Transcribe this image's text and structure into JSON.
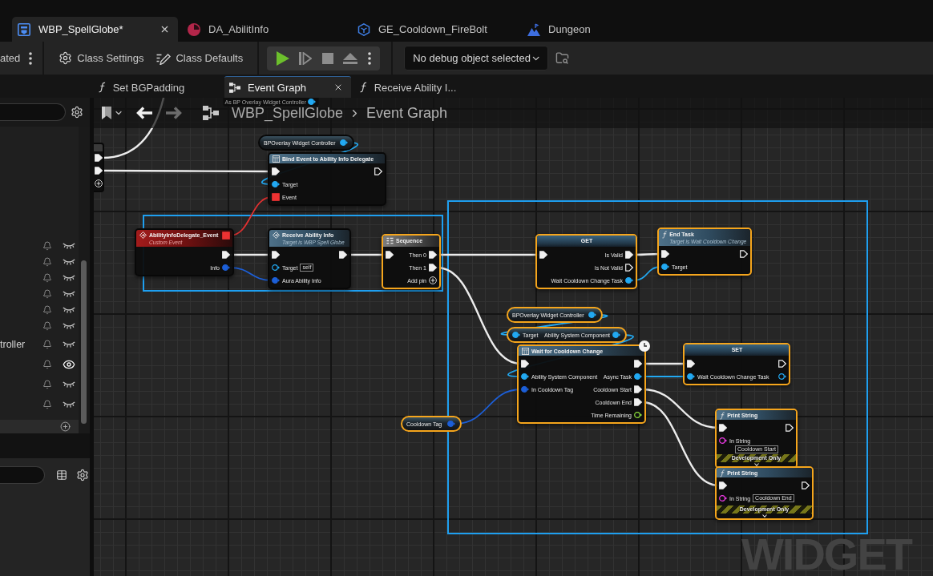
{
  "document_tabs": [
    {
      "label": "WBP_SpellGlobe*",
      "kind": "widget",
      "selected": true
    },
    {
      "label": "DA_AbilitInfo",
      "kind": "data_asset",
      "selected": false
    },
    {
      "label": "GE_Cooldown_FireBolt",
      "kind": "effect",
      "selected": false
    },
    {
      "label": "Dungeon",
      "kind": "level",
      "selected": false
    }
  ],
  "toolbar": {
    "buttons": [
      {
        "label": "ated",
        "kind": "plain"
      },
      {
        "label": "Class Settings",
        "kind": "settings"
      },
      {
        "label": "Class Defaults",
        "kind": "defaults"
      }
    ],
    "play_controls": [
      {
        "kind": "play",
        "disabled": false
      },
      {
        "kind": "step",
        "disabled": true
      },
      {
        "kind": "stop",
        "disabled": true
      },
      {
        "kind": "eject",
        "disabled": true
      }
    ],
    "debug_dropdown": {
      "value": "No debug object selected"
    }
  },
  "graph_tabs": [
    {
      "label": "Set BGPadding",
      "kind": "function",
      "selected": false
    },
    {
      "label": "Event Graph",
      "kind": "graph",
      "selected": true
    },
    {
      "label": "Receive Ability I...",
      "kind": "function",
      "selected": false
    }
  ],
  "left_panel": {
    "rows": [
      {
        "shown": false
      },
      {
        "shown": false
      },
      {
        "shown": false
      },
      {
        "shown": false
      },
      {
        "shown": false
      },
      {
        "shown": false
      },
      {
        "label": "troller",
        "shown": false
      },
      {
        "shown": true
      },
      {
        "shown": false
      },
      {
        "shown": false
      }
    ]
  },
  "breadcrumb": {
    "nav": [
      {
        "kind": "back",
        "disabled": false
      },
      {
        "kind": "forward",
        "disabled": true
      }
    ],
    "path": [
      "WBP_SpellGlobe",
      "Event Graph"
    ]
  },
  "graph": {
    "nodes": [
      {
        "kind": "fragment",
        "selected": false,
        "outputs": [
          {
            "kind": "exec",
            "connected": true
          },
          {
            "kind": "exec",
            "connected": true
          },
          {
            "kind": "add"
          }
        ]
      },
      {
        "kind": "partial",
        "selected": false,
        "outputs": [
          {
            "label": "As BP Overlay Widget Controller",
            "kind": "object",
            "connected": true
          }
        ]
      },
      {
        "kind": "getter",
        "title": "BPOverlay Widget Controller",
        "selected": false,
        "outputs": [
          {
            "kind": "object",
            "connected": true
          }
        ]
      },
      {
        "kind": "function",
        "title": "Bind Event to Ability Info Delegate",
        "icon": {
          "kind": "node"
        },
        "selected": false,
        "inputs": [
          {
            "kind": "exec",
            "connected": true
          },
          {
            "label": "Target",
            "kind": "object",
            "connected": true
          },
          {
            "label": "Event",
            "kind": "delegate",
            "connected": true
          }
        ],
        "outputs": [
          {
            "kind": "exec",
            "connected": false
          }
        ]
      },
      {
        "kind": "event",
        "title": "AbilityInfoDelegate_Event",
        "subtitle": "Custom Event",
        "icon": {
          "kind": "event"
        },
        "selected": false,
        "header_pin": {
          "kind": "delegate",
          "connected": true
        },
        "outputs": [
          {
            "kind": "exec",
            "connected": true
          },
          {
            "label": "Info",
            "kind": "struct",
            "connected": true
          }
        ]
      },
      {
        "kind": "function",
        "title": "Receive Ability Info",
        "subtitle": "Target is WBP Spell Globe",
        "icon": {
          "kind": "event"
        },
        "selected": false,
        "inputs": [
          {
            "kind": "exec",
            "connected": true
          },
          {
            "label": "Target",
            "kind": "object",
            "connected": false,
            "value": "self"
          },
          {
            "label": "Aura Ability Info",
            "kind": "struct",
            "connected": true
          }
        ],
        "outputs": [
          {
            "kind": "exec",
            "connected": true
          }
        ]
      },
      {
        "kind": "sequence",
        "title": "Sequence",
        "icon": {
          "kind": "sequence"
        },
        "selected": true,
        "inputs": [
          {
            "kind": "exec",
            "connected": true
          }
        ],
        "outputs": [
          {
            "label": "Then 0",
            "kind": "exec",
            "connected": true
          },
          {
            "label": "Then 1",
            "kind": "exec",
            "connected": true
          },
          {
            "label": "Add pin",
            "kind": "add"
          }
        ]
      },
      {
        "kind": "variable",
        "title": "GET",
        "selected": true,
        "inputs": [
          {
            "kind": "exec",
            "connected": true
          }
        ],
        "outputs": [
          {
            "label": "Is Valid",
            "kind": "exec",
            "connected": true
          },
          {
            "label": "Is Not Valid",
            "kind": "exec",
            "connected": false
          },
          {
            "label": "Wait Cooldown Change Task",
            "kind": "object",
            "connected": true
          }
        ]
      },
      {
        "kind": "function",
        "title": "End Task",
        "subtitle": "Target is Wait Cooldown Change",
        "icon": {
          "kind": "function"
        },
        "selected": true,
        "inputs": [
          {
            "kind": "exec",
            "connected": true
          },
          {
            "label": "Target",
            "kind": "object",
            "connected": true
          }
        ],
        "outputs": [
          {
            "kind": "exec",
            "connected": false
          }
        ]
      },
      {
        "kind": "getter",
        "title": "BPOverlay Widget Controller",
        "selected": true,
        "outputs": [
          {
            "kind": "object",
            "connected": true
          }
        ]
      },
      {
        "kind": "compact",
        "selected": true,
        "inputs": [
          {
            "label": "Target",
            "kind": "object",
            "connected": true
          }
        ],
        "outputs": [
          {
            "label": "Ability System Component",
            "kind": "object",
            "connected": true
          }
        ]
      },
      {
        "kind": "function",
        "title": "Wait for Cooldown Change",
        "icon": {
          "kind": "node"
        },
        "latent": true,
        "selected": true,
        "inputs": [
          {
            "kind": "exec",
            "connected": true
          },
          {
            "label": "Ability System Component",
            "kind": "object",
            "connected": true
          },
          {
            "label": "In Cooldown Tag",
            "kind": "struct",
            "connected": true
          }
        ],
        "outputs": [
          {
            "kind": "exec",
            "connected": true
          },
          {
            "label": "Async Task",
            "kind": "object",
            "connected": true
          },
          {
            "label": "Cooldown Start",
            "kind": "exec",
            "connected": true
          },
          {
            "label": "Cooldown End",
            "kind": "exec",
            "connected": true
          },
          {
            "label": "Time Remaining",
            "kind": "float",
            "connected": false
          }
        ]
      },
      {
        "kind": "variable",
        "title": "SET",
        "selected": true,
        "inputs": [
          {
            "kind": "exec",
            "connected": true
          },
          {
            "label": "Wait Cooldown Change Task",
            "kind": "object",
            "connected": true
          }
        ],
        "outputs": [
          {
            "kind": "exec",
            "connected": false
          },
          {
            "kind": "object",
            "connected": false
          }
        ]
      },
      {
        "kind": "getter",
        "title": "Cooldown Tag",
        "selected": true,
        "outputs": [
          {
            "kind": "struct",
            "connected": true
          }
        ]
      },
      {
        "kind": "function",
        "title": "Print String",
        "icon": {
          "kind": "function"
        },
        "selected": true,
        "inputs": [
          {
            "kind": "exec",
            "connected": true
          },
          {
            "label": "In String",
            "kind": "string",
            "connected": false,
            "value": "Cooldown Start"
          }
        ],
        "outputs": [
          {
            "kind": "exec",
            "connected": false
          }
        ],
        "footer": "Development Only"
      },
      {
        "kind": "function",
        "title": "Print String",
        "icon": {
          "kind": "function"
        },
        "selected": true,
        "inputs": [
          {
            "kind": "exec",
            "connected": true
          },
          {
            "label": "In String",
            "kind": "string",
            "connected": false,
            "value": "Cooldown End"
          }
        ],
        "outputs": [
          {
            "kind": "exec",
            "connected": false
          }
        ],
        "footer": "Development Only"
      }
    ],
    "corner_label": "WIDGET"
  }
}
